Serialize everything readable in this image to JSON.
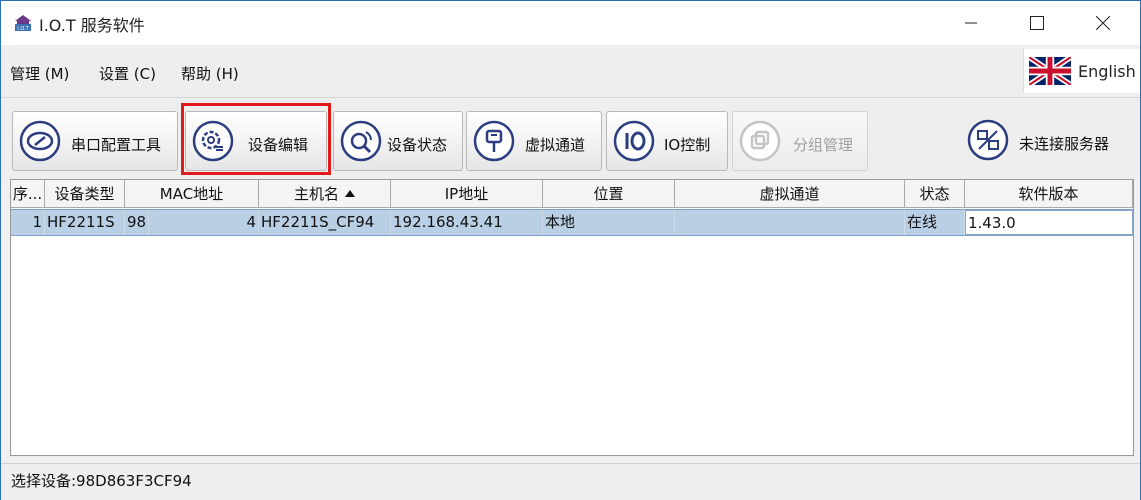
{
  "window": {
    "title": "I.O.T 服务软件",
    "app_icon_text": "I.O.T"
  },
  "menu": {
    "items": [
      "管理 (M)",
      "设置 (C)",
      "帮助 (H)"
    ],
    "language": "English"
  },
  "toolbar": {
    "buttons": [
      {
        "label": "串口配置工具",
        "icon": "serial-config-icon",
        "enabled": true
      },
      {
        "label": "设备编辑",
        "icon": "gear-edit-icon",
        "enabled": true,
        "highlighted": true
      },
      {
        "label": "设备状态",
        "icon": "device-status-icon",
        "enabled": true
      },
      {
        "label": "虚拟通道",
        "icon": "virtual-channel-icon",
        "enabled": true
      },
      {
        "label": "IO控制",
        "icon": "io-control-icon",
        "enabled": true
      },
      {
        "label": "分组管理",
        "icon": "group-manage-icon",
        "enabled": false
      },
      {
        "label": "未连接服务器",
        "icon": "server-disconnected-icon",
        "enabled": true
      }
    ],
    "highlight_color": "#e01b1b"
  },
  "table": {
    "columns": [
      "序...",
      "设备类型",
      "MAC地址",
      "主机名",
      "IP地址",
      "位置",
      "虚拟通道",
      "状态",
      "软件版本"
    ],
    "sorted_column": "主机名",
    "rows": [
      {
        "index": "1",
        "device_type": "HF2211S",
        "mac_left": "98",
        "mac_right": "4",
        "hostname": "HF2211S_CF94",
        "ip": "192.168.43.41",
        "location": "本地",
        "virtual_channel": "",
        "status": "在线",
        "version": "1.43.0"
      }
    ],
    "selected_row_color": "#b9cfe5"
  },
  "status": {
    "text": "选择设备:98D863F3CF94"
  }
}
